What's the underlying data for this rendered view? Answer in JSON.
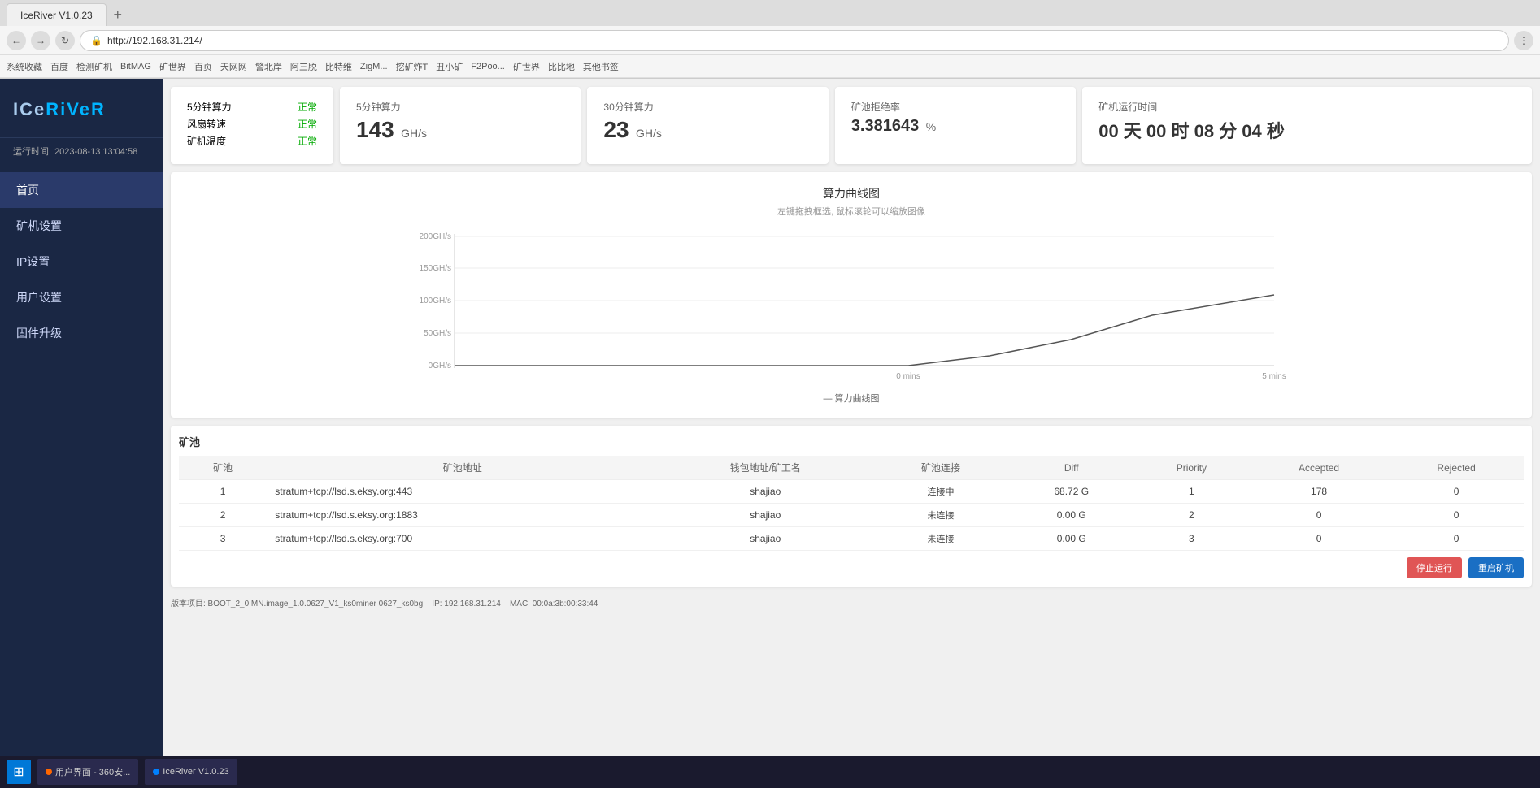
{
  "browser": {
    "tab_label": "IceRiver V1.0.23",
    "url": "http://192.168.31.214/",
    "bookmarks": [
      "系统收藏",
      "百度",
      "检测矿机",
      "BitMAG",
      "矿世界",
      "百页",
      "天网网",
      "警北岸",
      "阿三脱",
      "比特维",
      "ZigM...",
      "挖矿炸T",
      "丑小矿",
      "F2Poo...",
      "矿世界",
      "比比地",
      "其他书签"
    ]
  },
  "sidebar": {
    "logo": "ICeRiVeR",
    "logo_ice": "ICe",
    "logo_river": "RiVeR",
    "run_time_label": "运行时间",
    "run_time_value": "2023-08-13 13:04:58",
    "nav_items": [
      {
        "label": "首页",
        "active": true
      },
      {
        "label": "矿机设置",
        "active": false
      },
      {
        "label": "IP设置",
        "active": false
      },
      {
        "label": "用户设置",
        "active": false
      },
      {
        "label": "固件升级",
        "active": false
      }
    ]
  },
  "stats": {
    "card1": {
      "label1": "5分钟算力",
      "status1": "正常",
      "label2": "风扇转速",
      "status2": "正常",
      "label3": "矿机温度",
      "status3": "正常"
    },
    "card2": {
      "label": "5分钟算力",
      "value": "143",
      "unit": "GH/s"
    },
    "card3": {
      "label": "30分钟算力",
      "value": "23",
      "unit": "GH/s"
    },
    "card4": {
      "label": "矿池拒绝率",
      "value": "3.381643",
      "unit": "%"
    },
    "card5": {
      "label": "矿机运行时间",
      "value": "00 天 00 时 08 分 04 秒"
    }
  },
  "chart": {
    "title": "算力曲线图",
    "subtitle": "左键拖拽框选, 鼠标滚轮可以缩放图像",
    "y_labels": [
      "200GH/s",
      "150GH/s",
      "100GH/s",
      "50GH/s",
      "0GH/s"
    ],
    "x_labels": [
      "0 mins",
      "5 mins"
    ],
    "legend": "— 算力曲线图"
  },
  "pool_table": {
    "section_title": "矿池",
    "columns": [
      "矿池",
      "矿池地址",
      "钱包地址/矿工名",
      "矿池连接",
      "Diff",
      "Priority",
      "Accepted",
      "Rejected"
    ],
    "rows": [
      {
        "id": "1",
        "address": "stratum+tcp://lsd.s.eksy.org:443",
        "wallet": "shajiao",
        "status": "连接中",
        "status_class": "connected",
        "diff": "68.72 G",
        "priority": "1",
        "accepted": "178",
        "rejected": "0"
      },
      {
        "id": "2",
        "address": "stratum+tcp://lsd.s.eksy.org:1883",
        "wallet": "shajiao",
        "status": "未连接",
        "status_class": "disconnected",
        "diff": "0.00 G",
        "priority": "2",
        "accepted": "0",
        "rejected": "0"
      },
      {
        "id": "3",
        "address": "stratum+tcp://lsd.s.eksy.org:700",
        "wallet": "shajiao",
        "status": "未连接",
        "status_class": "disconnected",
        "diff": "0.00 G",
        "priority": "3",
        "accepted": "0",
        "rejected": "0"
      }
    ]
  },
  "footer": {
    "version": "版本项目: BOOT_2_0.MN.image_1.0.0627_V1_ks0miner 0627_ks0bg",
    "ip": "IP: 192.168.31.214",
    "mac": "MAC: 00:0a:3b:00:33:44"
  },
  "buttons": {
    "stop_label": "停止运行",
    "restart_label": "重启矿机"
  },
  "lang": "中文",
  "taskbar": {
    "user_btn": "用户界面 - 360安...",
    "iceriver_btn": "IceRiver V1.0.23"
  }
}
